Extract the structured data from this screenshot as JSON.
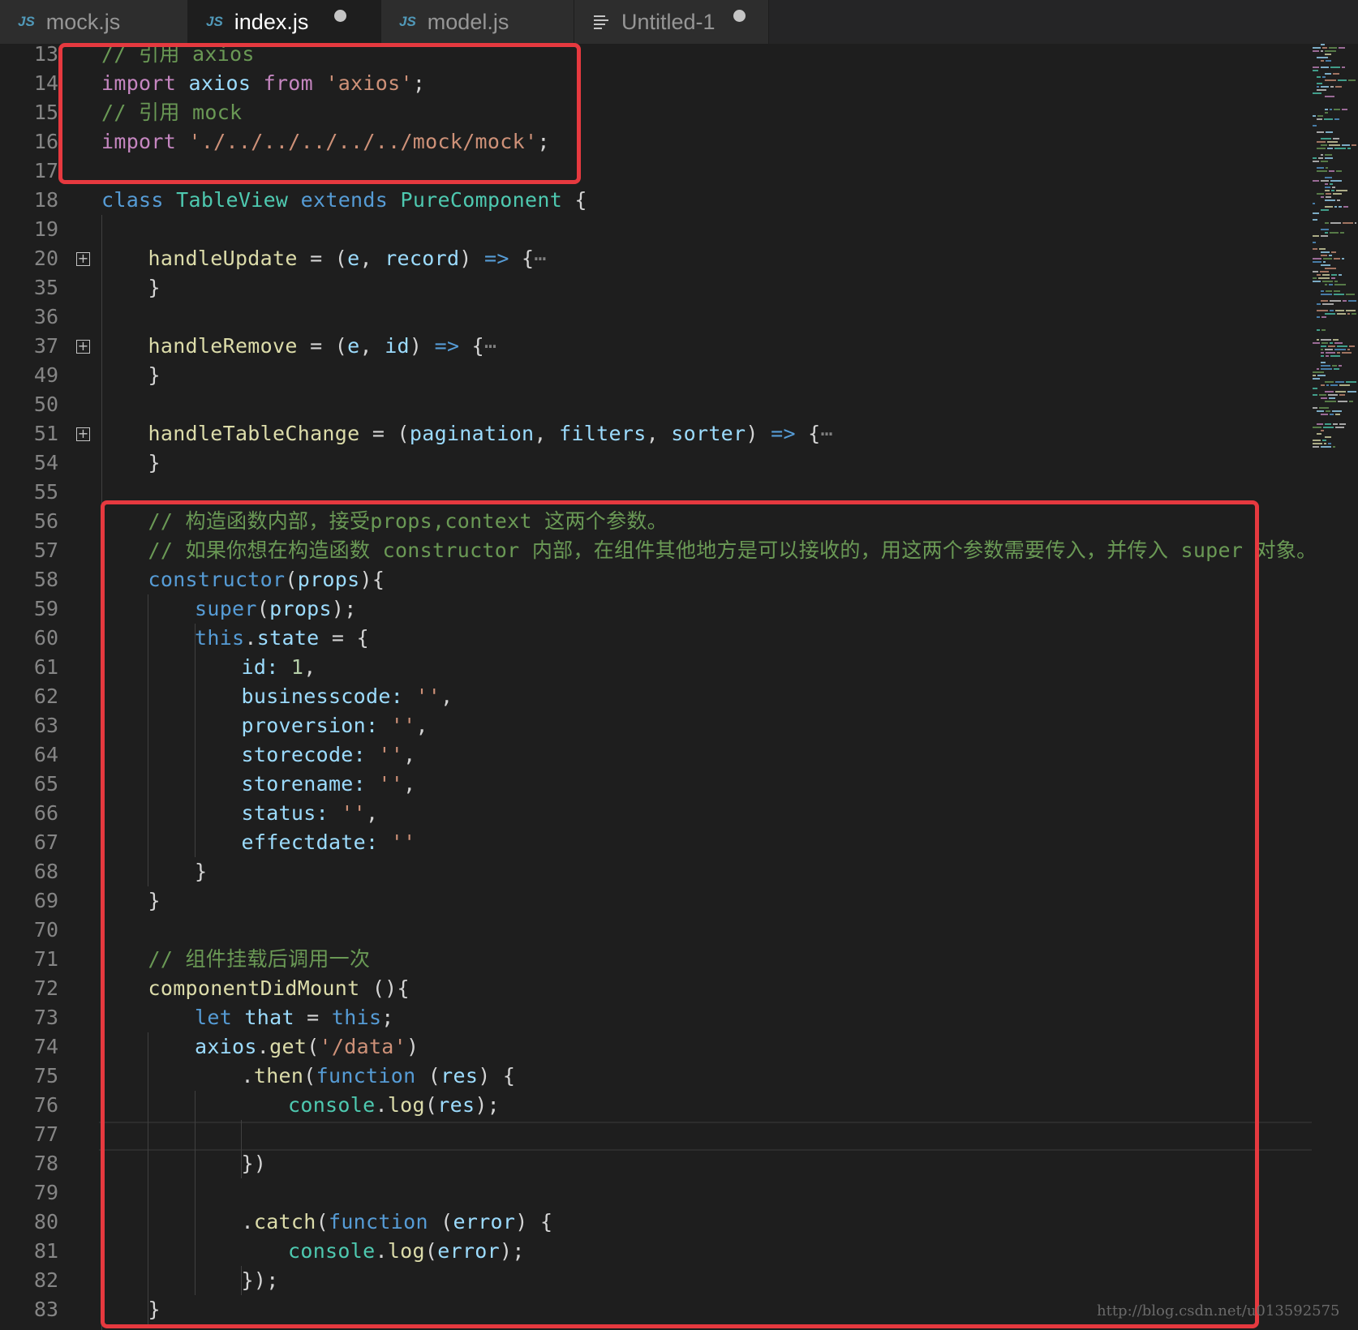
{
  "tabs": [
    {
      "label": "mock.js",
      "icon": "js-file-icon",
      "icon_text": "JS",
      "active": false,
      "dirty": false
    },
    {
      "label": "index.js",
      "icon": "js-file-icon",
      "icon_text": "JS",
      "active": true,
      "dirty": true
    },
    {
      "label": "model.js",
      "icon": "js-file-icon",
      "icon_text": "JS",
      "active": false,
      "dirty": false
    },
    {
      "label": "Untitled-1",
      "icon": "text-file-icon",
      "icon_text": "",
      "active": false,
      "dirty": true
    }
  ],
  "colors": {
    "background": "#1e1e1e",
    "highlight_box": "#e6393f",
    "keyword": "#c586c0",
    "storage": "#569cd6",
    "class": "#4ec9b0",
    "function": "#dcdcaa",
    "variable": "#9cdcfe",
    "string": "#ce9178",
    "number": "#b5cea8",
    "comment": "#6a9955"
  },
  "code_lines": [
    {
      "num": "13",
      "indent": 0,
      "tokens": [
        [
          "com",
          "// 引用 axios"
        ]
      ]
    },
    {
      "num": "14",
      "indent": 0,
      "tokens": [
        [
          "kw",
          "import"
        ],
        [
          "pun",
          " "
        ],
        [
          "var",
          "axios"
        ],
        [
          "pun",
          " "
        ],
        [
          "kw",
          "from"
        ],
        [
          "pun",
          " "
        ],
        [
          "str",
          "'axios'"
        ],
        [
          "pun",
          ";"
        ]
      ]
    },
    {
      "num": "15",
      "indent": 0,
      "tokens": [
        [
          "com",
          "// 引用 mock"
        ]
      ]
    },
    {
      "num": "16",
      "indent": 0,
      "tokens": [
        [
          "kw",
          "import"
        ],
        [
          "pun",
          " "
        ],
        [
          "str",
          "'./../../../../../mock/mock'"
        ],
        [
          "pun",
          ";"
        ]
      ]
    },
    {
      "num": "17",
      "indent": 0,
      "tokens": []
    },
    {
      "num": "18",
      "indent": 0,
      "tokens": [
        [
          "st",
          "class"
        ],
        [
          "pun",
          " "
        ],
        [
          "cls",
          "TableView"
        ],
        [
          "pun",
          " "
        ],
        [
          "st",
          "extends"
        ],
        [
          "pun",
          " "
        ],
        [
          "cls",
          "PureComponent"
        ],
        [
          "pun",
          " {"
        ]
      ]
    },
    {
      "num": "19",
      "indent": 0,
      "tokens": []
    },
    {
      "num": "20",
      "indent": 1,
      "fold": true,
      "tokens": [
        [
          "fn",
          "handleUpdate"
        ],
        [
          "pun",
          " = ("
        ],
        [
          "var",
          "e"
        ],
        [
          "pun",
          ", "
        ],
        [
          "var",
          "record"
        ],
        [
          "pun",
          ") "
        ],
        [
          "st",
          "=>"
        ],
        [
          "pun",
          " {"
        ],
        [
          "dim",
          "⋯"
        ]
      ]
    },
    {
      "num": "35",
      "indent": 1,
      "tokens": [
        [
          "pun",
          "}"
        ]
      ]
    },
    {
      "num": "36",
      "indent": 0,
      "tokens": []
    },
    {
      "num": "37",
      "indent": 1,
      "fold": true,
      "tokens": [
        [
          "fn",
          "handleRemove"
        ],
        [
          "pun",
          " = ("
        ],
        [
          "var",
          "e"
        ],
        [
          "pun",
          ", "
        ],
        [
          "var",
          "id"
        ],
        [
          "pun",
          ") "
        ],
        [
          "st",
          "=>"
        ],
        [
          "pun",
          " {"
        ],
        [
          "dim",
          "⋯"
        ]
      ]
    },
    {
      "num": "49",
      "indent": 1,
      "tokens": [
        [
          "pun",
          "}"
        ]
      ]
    },
    {
      "num": "50",
      "indent": 0,
      "tokens": []
    },
    {
      "num": "51",
      "indent": 1,
      "fold": true,
      "tokens": [
        [
          "fn",
          "handleTableChange"
        ],
        [
          "pun",
          " = ("
        ],
        [
          "var",
          "pagination"
        ],
        [
          "pun",
          ", "
        ],
        [
          "var",
          "filters"
        ],
        [
          "pun",
          ", "
        ],
        [
          "var",
          "sorter"
        ],
        [
          "pun",
          ") "
        ],
        [
          "st",
          "=>"
        ],
        [
          "pun",
          " {"
        ],
        [
          "dim",
          "⋯"
        ]
      ]
    },
    {
      "num": "54",
      "indent": 1,
      "tokens": [
        [
          "pun",
          "}"
        ]
      ]
    },
    {
      "num": "55",
      "indent": 0,
      "tokens": []
    },
    {
      "num": "56",
      "indent": 1,
      "tokens": [
        [
          "com",
          "// 构造函数内部，接受props,context 这两个参数。"
        ]
      ]
    },
    {
      "num": "57",
      "indent": 1,
      "tokens": [
        [
          "com",
          "// 如果你想在构造函数 constructor 内部，在组件其他地方是可以接收的，用这两个参数需要传入，并传入 super 对象。"
        ]
      ]
    },
    {
      "num": "58",
      "indent": 1,
      "tokens": [
        [
          "st",
          "constructor"
        ],
        [
          "pun",
          "("
        ],
        [
          "var",
          "props"
        ],
        [
          "pun",
          "){"
        ]
      ]
    },
    {
      "num": "59",
      "indent": 2,
      "tokens": [
        [
          "st",
          "super"
        ],
        [
          "pun",
          "("
        ],
        [
          "var",
          "props"
        ],
        [
          "pun",
          ");"
        ]
      ]
    },
    {
      "num": "60",
      "indent": 2,
      "tokens": [
        [
          "st",
          "this"
        ],
        [
          "pun",
          "."
        ],
        [
          "var",
          "state"
        ],
        [
          "pun",
          " = {"
        ]
      ]
    },
    {
      "num": "61",
      "indent": 3,
      "tokens": [
        [
          "var",
          "id"
        ],
        [
          "var",
          ":"
        ],
        [
          "pun",
          " "
        ],
        [
          "num",
          "1"
        ],
        [
          "pun",
          ","
        ]
      ]
    },
    {
      "num": "62",
      "indent": 3,
      "tokens": [
        [
          "var",
          "businesscode"
        ],
        [
          "var",
          ":"
        ],
        [
          "pun",
          " "
        ],
        [
          "str",
          "''"
        ],
        [
          "pun",
          ","
        ]
      ]
    },
    {
      "num": "63",
      "indent": 3,
      "tokens": [
        [
          "var",
          "proversion"
        ],
        [
          "var",
          ":"
        ],
        [
          "pun",
          " "
        ],
        [
          "str",
          "''"
        ],
        [
          "pun",
          ","
        ]
      ]
    },
    {
      "num": "64",
      "indent": 3,
      "tokens": [
        [
          "var",
          "storecode"
        ],
        [
          "var",
          ":"
        ],
        [
          "pun",
          " "
        ],
        [
          "str",
          "''"
        ],
        [
          "pun",
          ","
        ]
      ]
    },
    {
      "num": "65",
      "indent": 3,
      "tokens": [
        [
          "var",
          "storename"
        ],
        [
          "var",
          ":"
        ],
        [
          "pun",
          " "
        ],
        [
          "str",
          "''"
        ],
        [
          "pun",
          ","
        ]
      ]
    },
    {
      "num": "66",
      "indent": 3,
      "tokens": [
        [
          "var",
          "status"
        ],
        [
          "var",
          ":"
        ],
        [
          "pun",
          " "
        ],
        [
          "str",
          "''"
        ],
        [
          "pun",
          ","
        ]
      ]
    },
    {
      "num": "67",
      "indent": 3,
      "tokens": [
        [
          "var",
          "effectdate"
        ],
        [
          "var",
          ":"
        ],
        [
          "pun",
          " "
        ],
        [
          "str",
          "''"
        ]
      ]
    },
    {
      "num": "68",
      "indent": 2,
      "tokens": [
        [
          "pun",
          "}"
        ]
      ]
    },
    {
      "num": "69",
      "indent": 1,
      "tokens": [
        [
          "pun",
          "}"
        ]
      ]
    },
    {
      "num": "70",
      "indent": 0,
      "tokens": []
    },
    {
      "num": "71",
      "indent": 1,
      "tokens": [
        [
          "com",
          "// 组件挂载后调用一次"
        ]
      ]
    },
    {
      "num": "72",
      "indent": 1,
      "tokens": [
        [
          "fn",
          "componentDidMount"
        ],
        [
          "pun",
          " (){"
        ]
      ]
    },
    {
      "num": "73",
      "indent": 2,
      "tokens": [
        [
          "st",
          "let"
        ],
        [
          "pun",
          " "
        ],
        [
          "var",
          "that"
        ],
        [
          "pun",
          " = "
        ],
        [
          "st",
          "this"
        ],
        [
          "pun",
          ";"
        ]
      ]
    },
    {
      "num": "74",
      "indent": 2,
      "tokens": [
        [
          "var",
          "axios"
        ],
        [
          "pun",
          "."
        ],
        [
          "fn",
          "get"
        ],
        [
          "pun",
          "("
        ],
        [
          "str",
          "'/data'"
        ],
        [
          "pun",
          ")"
        ]
      ]
    },
    {
      "num": "75",
      "indent": 3,
      "tokens": [
        [
          "pun",
          "."
        ],
        [
          "fn",
          "then"
        ],
        [
          "pun",
          "("
        ],
        [
          "st",
          "function"
        ],
        [
          "pun",
          " ("
        ],
        [
          "var",
          "res"
        ],
        [
          "pun",
          ") {"
        ]
      ]
    },
    {
      "num": "76",
      "indent": 4,
      "tokens": [
        [
          "cls",
          "console"
        ],
        [
          "pun",
          "."
        ],
        [
          "fn",
          "log"
        ],
        [
          "pun",
          "("
        ],
        [
          "var",
          "res"
        ],
        [
          "pun",
          ");"
        ]
      ]
    },
    {
      "num": "77",
      "indent": 0,
      "tokens": []
    },
    {
      "num": "78",
      "indent": 3,
      "tokens": [
        [
          "pun",
          "})"
        ]
      ]
    },
    {
      "num": "79",
      "indent": 0,
      "tokens": []
    },
    {
      "num": "80",
      "indent": 3,
      "tokens": [
        [
          "pun",
          "."
        ],
        [
          "fn",
          "catch"
        ],
        [
          "pun",
          "("
        ],
        [
          "st",
          "function"
        ],
        [
          "pun",
          " ("
        ],
        [
          "var",
          "error"
        ],
        [
          "pun",
          ") {"
        ]
      ]
    },
    {
      "num": "81",
      "indent": 4,
      "tokens": [
        [
          "cls",
          "console"
        ],
        [
          "pun",
          "."
        ],
        [
          "fn",
          "log"
        ],
        [
          "pun",
          "("
        ],
        [
          "var",
          "error"
        ],
        [
          "pun",
          ");"
        ]
      ]
    },
    {
      "num": "82",
      "indent": 3,
      "tokens": [
        [
          "pun",
          "});"
        ]
      ]
    },
    {
      "num": "83",
      "indent": 1,
      "tokens": [
        [
          "pun",
          "}"
        ]
      ]
    }
  ],
  "watermark": "http://blog.csdn.net/u013592575"
}
